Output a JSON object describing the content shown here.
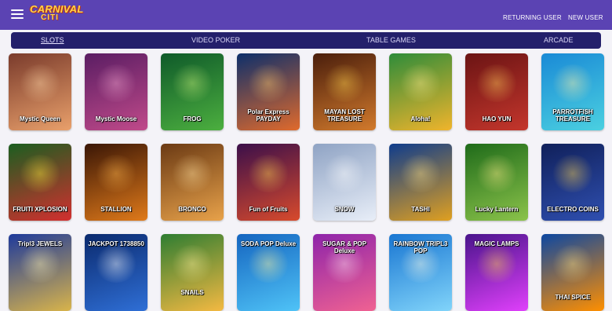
{
  "header": {
    "logo_top": "CARNIVAL",
    "logo_bottom": "CITI",
    "returning_user": "RETURNING USER",
    "new_user": "NEW USER",
    "background": "#5b43b3"
  },
  "nav": {
    "background": "#24206b",
    "items": [
      {
        "label": "SLOTS",
        "active": true
      },
      {
        "label": "VIDEO POKER",
        "active": false
      },
      {
        "label": "TABLE GAMES",
        "active": false
      },
      {
        "label": "ARCADE",
        "active": false
      }
    ]
  },
  "games": {
    "row1": [
      {
        "title": "Mystic Queen",
        "colors": [
          "#7a3b2c",
          "#e9a06b"
        ],
        "glow": "#ffd8a8"
      },
      {
        "title": "Mystic Moose",
        "colors": [
          "#5a1d63",
          "#c04a8a"
        ],
        "glow": "#f2a7d0"
      },
      {
        "title": "FROG",
        "colors": [
          "#0f5a2a",
          "#4caf3f"
        ],
        "glow": "#c8f07a"
      },
      {
        "title": "Polar Express PAYDAY",
        "colors": [
          "#0d2f6b",
          "#e06a2c"
        ],
        "glow": "#ffc86a"
      },
      {
        "title": "MAYAN LOST TREASURE",
        "colors": [
          "#4a1e0c",
          "#d27a2c"
        ],
        "glow": "#ffd34d"
      },
      {
        "title": "Aloha!",
        "colors": [
          "#2e8c3a",
          "#f0b42c"
        ],
        "glow": "#ffe98a"
      },
      {
        "title": "HAO YUN",
        "colors": [
          "#6b1414",
          "#c4362c"
        ],
        "glow": "#ffcf5a"
      },
      {
        "title": "PARROTFISH TREASURE",
        "colors": [
          "#1a8ad6",
          "#4bd0e0"
        ],
        "glow": "#fff1a6"
      }
    ],
    "row2": [
      {
        "title": "FRUITI XPLOSION",
        "colors": [
          "#1b5e20",
          "#d32f2f"
        ],
        "glow": "#ffeb3b"
      },
      {
        "title": "STALLION",
        "colors": [
          "#3a1606",
          "#e07a1a"
        ],
        "glow": "#ffb74d"
      },
      {
        "title": "BRONCO",
        "colors": [
          "#6b3a14",
          "#e8a24a"
        ],
        "glow": "#ffe0a0"
      },
      {
        "title": "Fun of Fruits",
        "colors": [
          "#3b0f4a",
          "#d84a2c"
        ],
        "glow": "#ffd54f"
      },
      {
        "title": "SNOW",
        "colors": [
          "#8fa3c4",
          "#e8eef8"
        ],
        "glow": "#ffffff"
      },
      {
        "title": "TASHI",
        "colors": [
          "#0f3c8c",
          "#e0a020"
        ],
        "glow": "#ffe082"
      },
      {
        "title": "Lucky Lantern",
        "colors": [
          "#1f6b1a",
          "#8bc34a"
        ],
        "glow": "#ffeb8a"
      },
      {
        "title": "ELECTRO COINS",
        "colors": [
          "#10205a",
          "#2f4fb0"
        ],
        "glow": "#ffd54f"
      }
    ],
    "row3": [
      {
        "title": "Tripl3 JEWELS",
        "colors": [
          "#1e3a9c",
          "#d9b44a"
        ],
        "glow": "#fff3b0"
      },
      {
        "title": "JACKPOT 1738850",
        "colors": [
          "#0b2a6e",
          "#2f6fd6"
        ],
        "glow": "#ffffff"
      },
      {
        "title": "SNAILS",
        "colors": [
          "#2e7d32",
          "#f4b942"
        ],
        "glow": "#ffef9a"
      },
      {
        "title": "SODA POP Deluxe",
        "colors": [
          "#1565c0",
          "#4fc3f7"
        ],
        "glow": "#fff59d"
      },
      {
        "title": "SUGAR & POP Deluxe",
        "colors": [
          "#8e24aa",
          "#f06292"
        ],
        "glow": "#ffe0f0"
      },
      {
        "title": "RAINBOW TRIPL3 POP",
        "colors": [
          "#1976d2",
          "#81d4fa"
        ],
        "glow": "#fffde7"
      },
      {
        "title": "MAGIC LAMPS",
        "colors": [
          "#4a148c",
          "#e040fb"
        ],
        "glow": "#ffd54f"
      },
      {
        "title": "THAI SPICE",
        "colors": [
          "#0d47a1",
          "#ff8f00"
        ],
        "glow": "#ffe082"
      }
    ]
  }
}
